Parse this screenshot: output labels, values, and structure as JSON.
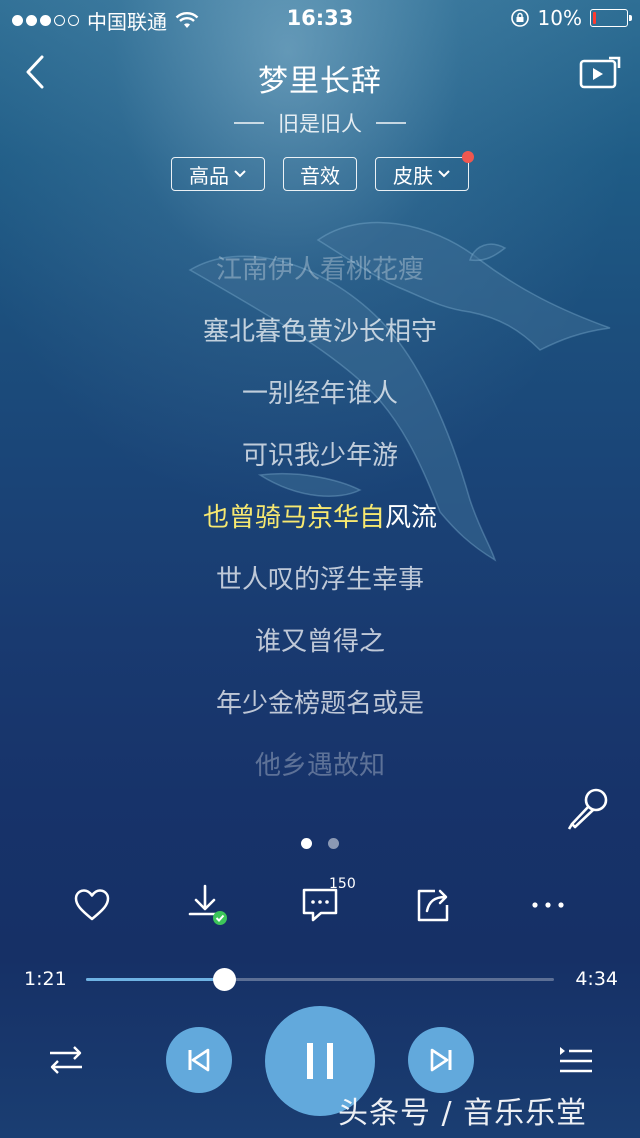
{
  "status_bar": {
    "carrier": "中国联通",
    "time": "16:33",
    "battery_percent": "10%",
    "battery_level": 0.1,
    "signal_bars": 3,
    "signal_total": 5
  },
  "header": {
    "song_title": "梦里长辞",
    "artist": "旧是旧人"
  },
  "options": [
    {
      "label": "高品",
      "has_dropdown": true
    },
    {
      "label": "音效",
      "has_dropdown": false
    },
    {
      "label": "皮肤",
      "has_dropdown": true,
      "has_badge": true
    }
  ],
  "lyrics": {
    "lines": [
      "江南伊人看桃花瘦",
      "塞北暮色黄沙长相守",
      "一别经年谁人",
      "可识我少年游",
      "也曾骑马京华自风流",
      "世人叹的浮生幸事",
      "谁又曾得之",
      "年少金榜题名或是",
      "他乡遇故知"
    ],
    "current_index": 4,
    "current_sung": "也曾骑马京华自",
    "current_rest": "风流"
  },
  "pager": {
    "total": 2,
    "active": 0
  },
  "actions": {
    "comment_count": "150"
  },
  "progress": {
    "current": "1:21",
    "total": "4:34",
    "fraction": 0.2956
  },
  "watermark": "头条号 / 音乐乐堂",
  "colors": {
    "accent": "#62a9dc",
    "highlight_lyric": "#f7e870",
    "badge_red": "#f0574f",
    "download_check": "#3dc55a"
  }
}
